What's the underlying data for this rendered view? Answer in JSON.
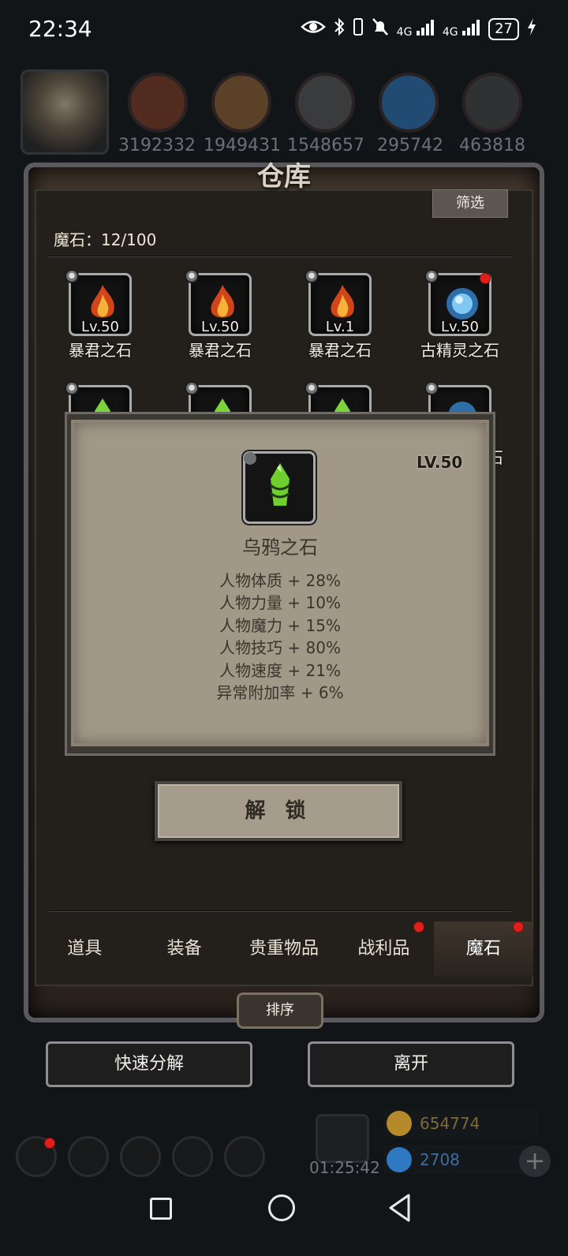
{
  "status_bar": {
    "time": "22:34",
    "network_a": "4G",
    "network_b": "4G",
    "battery": "27"
  },
  "resources": [
    {
      "icon": "ore-icon",
      "value": "3192332",
      "color": "#8a4a2a"
    },
    {
      "icon": "wood-icon",
      "value": "1949431",
      "color": "#9b6a3a"
    },
    {
      "icon": "stone-icon",
      "value": "1548657",
      "color": "#6d6d6d"
    },
    {
      "icon": "crystal-icon",
      "value": "295742",
      "color": "#3a86c9"
    },
    {
      "icon": "iron-icon",
      "value": "463818",
      "color": "#5a5a5a"
    }
  ],
  "warehouse": {
    "title": "仓库",
    "filter_label": "筛选",
    "stone_count": "魔石：12/100"
  },
  "items": [
    {
      "name": "暴君之石",
      "level": "Lv.50",
      "type": "fire"
    },
    {
      "name": "暴君之石",
      "level": "Lv.50",
      "type": "fire"
    },
    {
      "name": "暴君之石",
      "level": "Lv.1",
      "type": "fire"
    },
    {
      "name": "古精灵之石",
      "level": "Lv.50",
      "type": "blue",
      "has_badge": true
    },
    {
      "name": "",
      "level": "",
      "type": "green"
    },
    {
      "name": "",
      "level": "",
      "type": "green"
    },
    {
      "name": "",
      "level": "",
      "type": "green"
    },
    {
      "name": "石",
      "level": "",
      "type": "blue"
    }
  ],
  "detail": {
    "level": "LV.50",
    "name": "乌鸦之石",
    "stats": [
      "人物体质 + 28%",
      "人物力量 + 10%",
      "人物魔力 + 15%",
      "人物技巧 + 80%",
      "人物速度 + 21%",
      "异常附加率 + 6%"
    ],
    "unlock_label": "解 锁"
  },
  "tabs": [
    {
      "label": "道具",
      "badge": false
    },
    {
      "label": "装备",
      "badge": false
    },
    {
      "label": "贵重物品",
      "badge": false
    },
    {
      "label": "战利品",
      "badge": true
    },
    {
      "label": "魔石",
      "badge": true,
      "active": true
    }
  ],
  "sort_label": "排序",
  "actions": {
    "quick_decompose": "快速分解",
    "leave": "离开"
  },
  "hud": {
    "timer": "01:25:42",
    "gold": "654774",
    "gems": "2708"
  }
}
